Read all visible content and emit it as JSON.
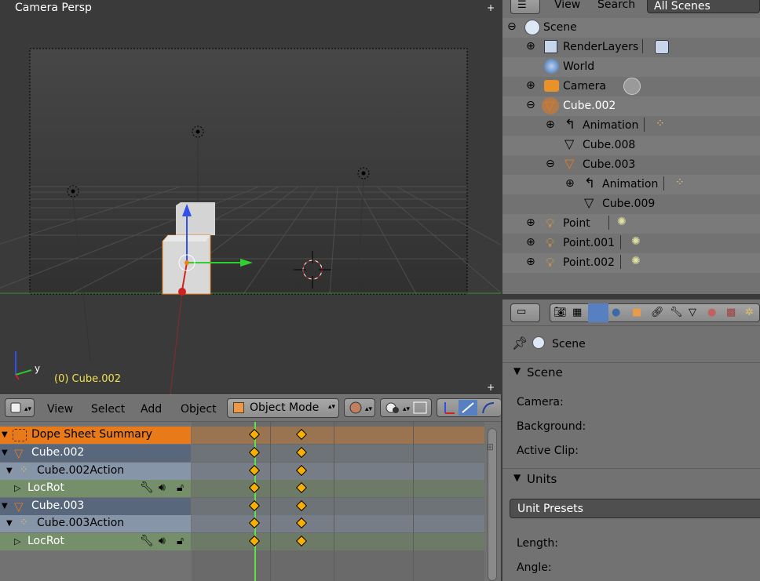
{
  "viewport": {
    "title": "Camera Persp",
    "active_object": "(0) Cube.002",
    "axis_y": "y"
  },
  "view3d_header": {
    "menus": [
      "View",
      "Select",
      "Add",
      "Object"
    ],
    "mode": "Object Mode"
  },
  "dopesheet": {
    "channels": [
      {
        "label": "Dope Sheet Summary",
        "kind": "summary"
      },
      {
        "label": "Cube.002",
        "kind": "object"
      },
      {
        "label": "Cube.002Action",
        "kind": "action"
      },
      {
        "label": "LocRot",
        "kind": "group"
      },
      {
        "label": "Cube.003",
        "kind": "object"
      },
      {
        "label": "Cube.003Action",
        "kind": "action"
      },
      {
        "label": "LocRot",
        "kind": "group"
      }
    ]
  },
  "outliner": {
    "header_menus": [
      "View",
      "Search"
    ],
    "scene_filter": "All Scenes",
    "items": [
      {
        "label": "Scene"
      },
      {
        "label": "RenderLayers"
      },
      {
        "label": "World"
      },
      {
        "label": "Camera"
      },
      {
        "label": "Cube.002"
      },
      {
        "label": "Animation"
      },
      {
        "label": "Cube.008"
      },
      {
        "label": "Cube.003"
      },
      {
        "label": "Animation"
      },
      {
        "label": "Cube.009"
      },
      {
        "label": "Point"
      },
      {
        "label": "Point.001"
      },
      {
        "label": "Point.002"
      }
    ]
  },
  "properties": {
    "context_label": "Scene",
    "scene_panel_title": "Scene",
    "camera_label": "Camera:",
    "background_label": "Background:",
    "active_clip_label": "Active Clip:",
    "units_panel_title": "Units",
    "unit_presets_label": "Unit Presets",
    "length_label": "Length:",
    "angle_label": "Angle:"
  },
  "colors": {
    "selected_orange": "#e97a19",
    "keyframe": "#f5b000",
    "active_text": "#f0e050",
    "current_frame": "#5fe04a"
  }
}
